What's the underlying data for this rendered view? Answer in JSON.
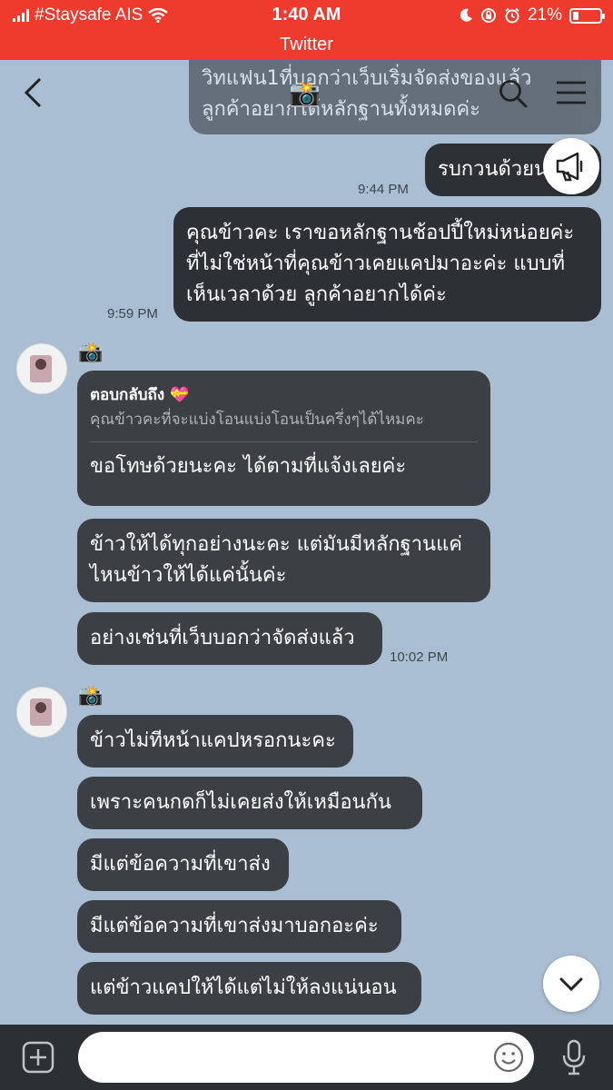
{
  "status": {
    "carrier": "#Staysafe AIS",
    "time": "1:40 AM",
    "battery": "21%",
    "battery_level": 0.21
  },
  "app_back": "Twitter",
  "header": {
    "title_icon": "📸"
  },
  "messages": {
    "m1": {
      "line1": "วิทแฟน1ที่บอกว่าเว็บเริ่มจัดส่งของแล้ว",
      "line2": "ลูกค้าอยากได้หลักฐานทั้งหมดค่ะ"
    },
    "m2": {
      "text": "รบกวนด้วยนะคะ",
      "time": "9:44 PM"
    },
    "m3": {
      "line1": "คุณข้าวคะ เราขอหลักฐานช้อปปี้ใหม่หน่อยค่ะ",
      "line2": "ที่ไม่ใช่หน้าที่คุณข้าวเคยแคปมาอะค่ะ แบบที่",
      "line3": "เห็นเวลาด้วย ลูกค้าอยากได้ค่ะ",
      "time": "9:59 PM"
    },
    "g1": {
      "sender_icon": "📸",
      "reply_label": "ตอบกลับถึง",
      "reply_emoji": "💝",
      "reply_quote": "คุณข้าวคะที่จะแบ่งโอนแบ่งโอนเป็นครึ่งๆได้ไหมคะ",
      "reply_text": "ขอโทษด้วยนะคะ ได้ตามที่แจ้งเลยค่ะ",
      "b2_line1": "ข้าวให้ได้ทุกอย่างนะคะ แต่มันมีหลักฐานแค่",
      "b2_line2": "ไหนข้าวให้ได้แค่นั้นค่ะ",
      "b3": "อย่างเช่นที่เว็บบอกว่าจัดส่งแล้ว",
      "time": "10:02 PM"
    },
    "g2": {
      "sender_icon": "📸",
      "b1": "ข้าวไม่ทีหน้าแคปหรอกนะคะ",
      "b2": "เพราะคนกดก็ไม่เคยส่งให้เหมือนกัน",
      "b3": "มีแต่ข้อความที่เขาส่ง",
      "b4": "มีแต่ข้อความที่เขาส่งมาบอกอะค่ะ",
      "b5": "แต่ข้าวแคปให้ได้แต่ไม่ให้ลงแน่นอน"
    }
  },
  "input": {
    "placeholder": ""
  }
}
